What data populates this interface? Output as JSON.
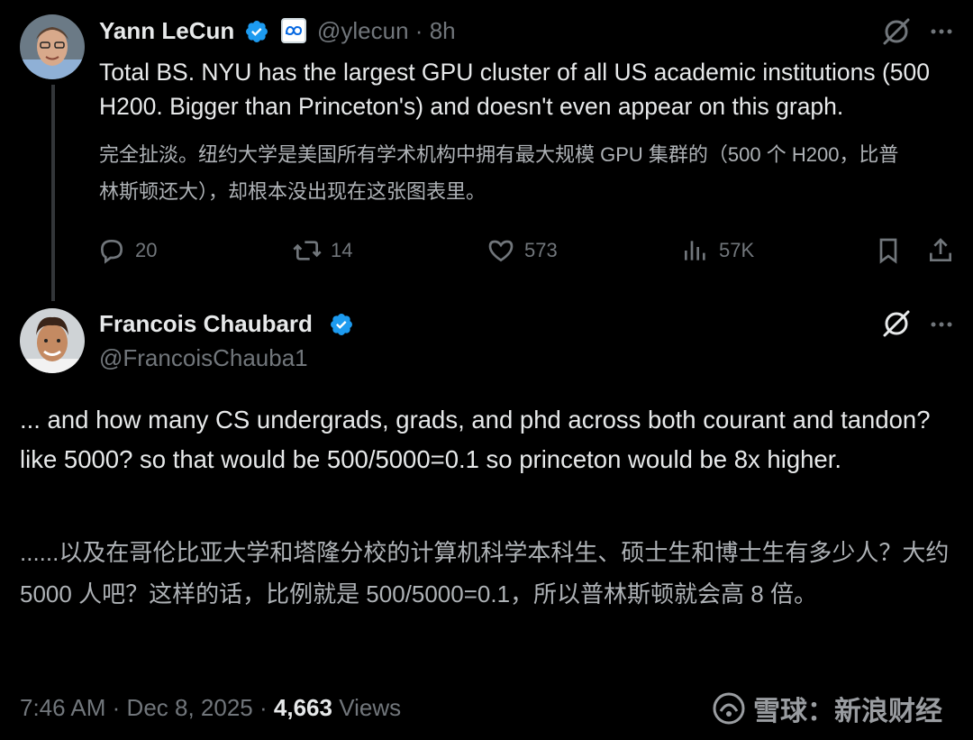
{
  "reply": {
    "author_name": "Yann LeCun",
    "handle": "@ylecun",
    "separator": "·",
    "time": "8h",
    "text": "Total BS. NYU has the largest GPU cluster of all US academic institutions (500 H200. Bigger than Princeton's) and doesn't even appear on this graph.",
    "translation": "完全扯淡。纽约大学是美国所有学术机构中拥有最大规模 GPU 集群的（500 个 H200，比普林斯顿还大），却根本没出现在这张图表里。",
    "replies": "20",
    "reposts": "14",
    "likes": "573",
    "views": "57K",
    "icons": [
      "verified-badge-icon",
      "meta-logo-icon",
      "grok-icon",
      "more-icon",
      "reply-icon",
      "repost-icon",
      "like-icon",
      "views-icon",
      "bookmark-icon",
      "share-icon"
    ]
  },
  "main": {
    "author_name": "Francois Chaubard",
    "handle": "@FrancoisChauba1",
    "text": "... and how many CS undergrads, grads, and phd across both courant and tandon? like 5000? so that would be 500/5000=0.1 so princeton would be 8x higher.",
    "translation": "......以及在哥伦比亚大学和塔隆分校的计算机科学本科生、硕士生和博士生有多少人？大约 5000 人吧？这样的话，比例就是 500/5000=0.1，所以普林斯顿就会高 8 倍。",
    "time": "7:46 AM",
    "separator": "·",
    "date": "Dec 8, 2025",
    "views_count": "4,663",
    "views_label": "Views"
  },
  "watermark": {
    "text": "雪球：新浪财经"
  },
  "colors": {
    "background": "#000000",
    "text_primary": "#e7e9ea",
    "text_secondary": "#71767b",
    "verified_blue": "#1d9bf0"
  }
}
